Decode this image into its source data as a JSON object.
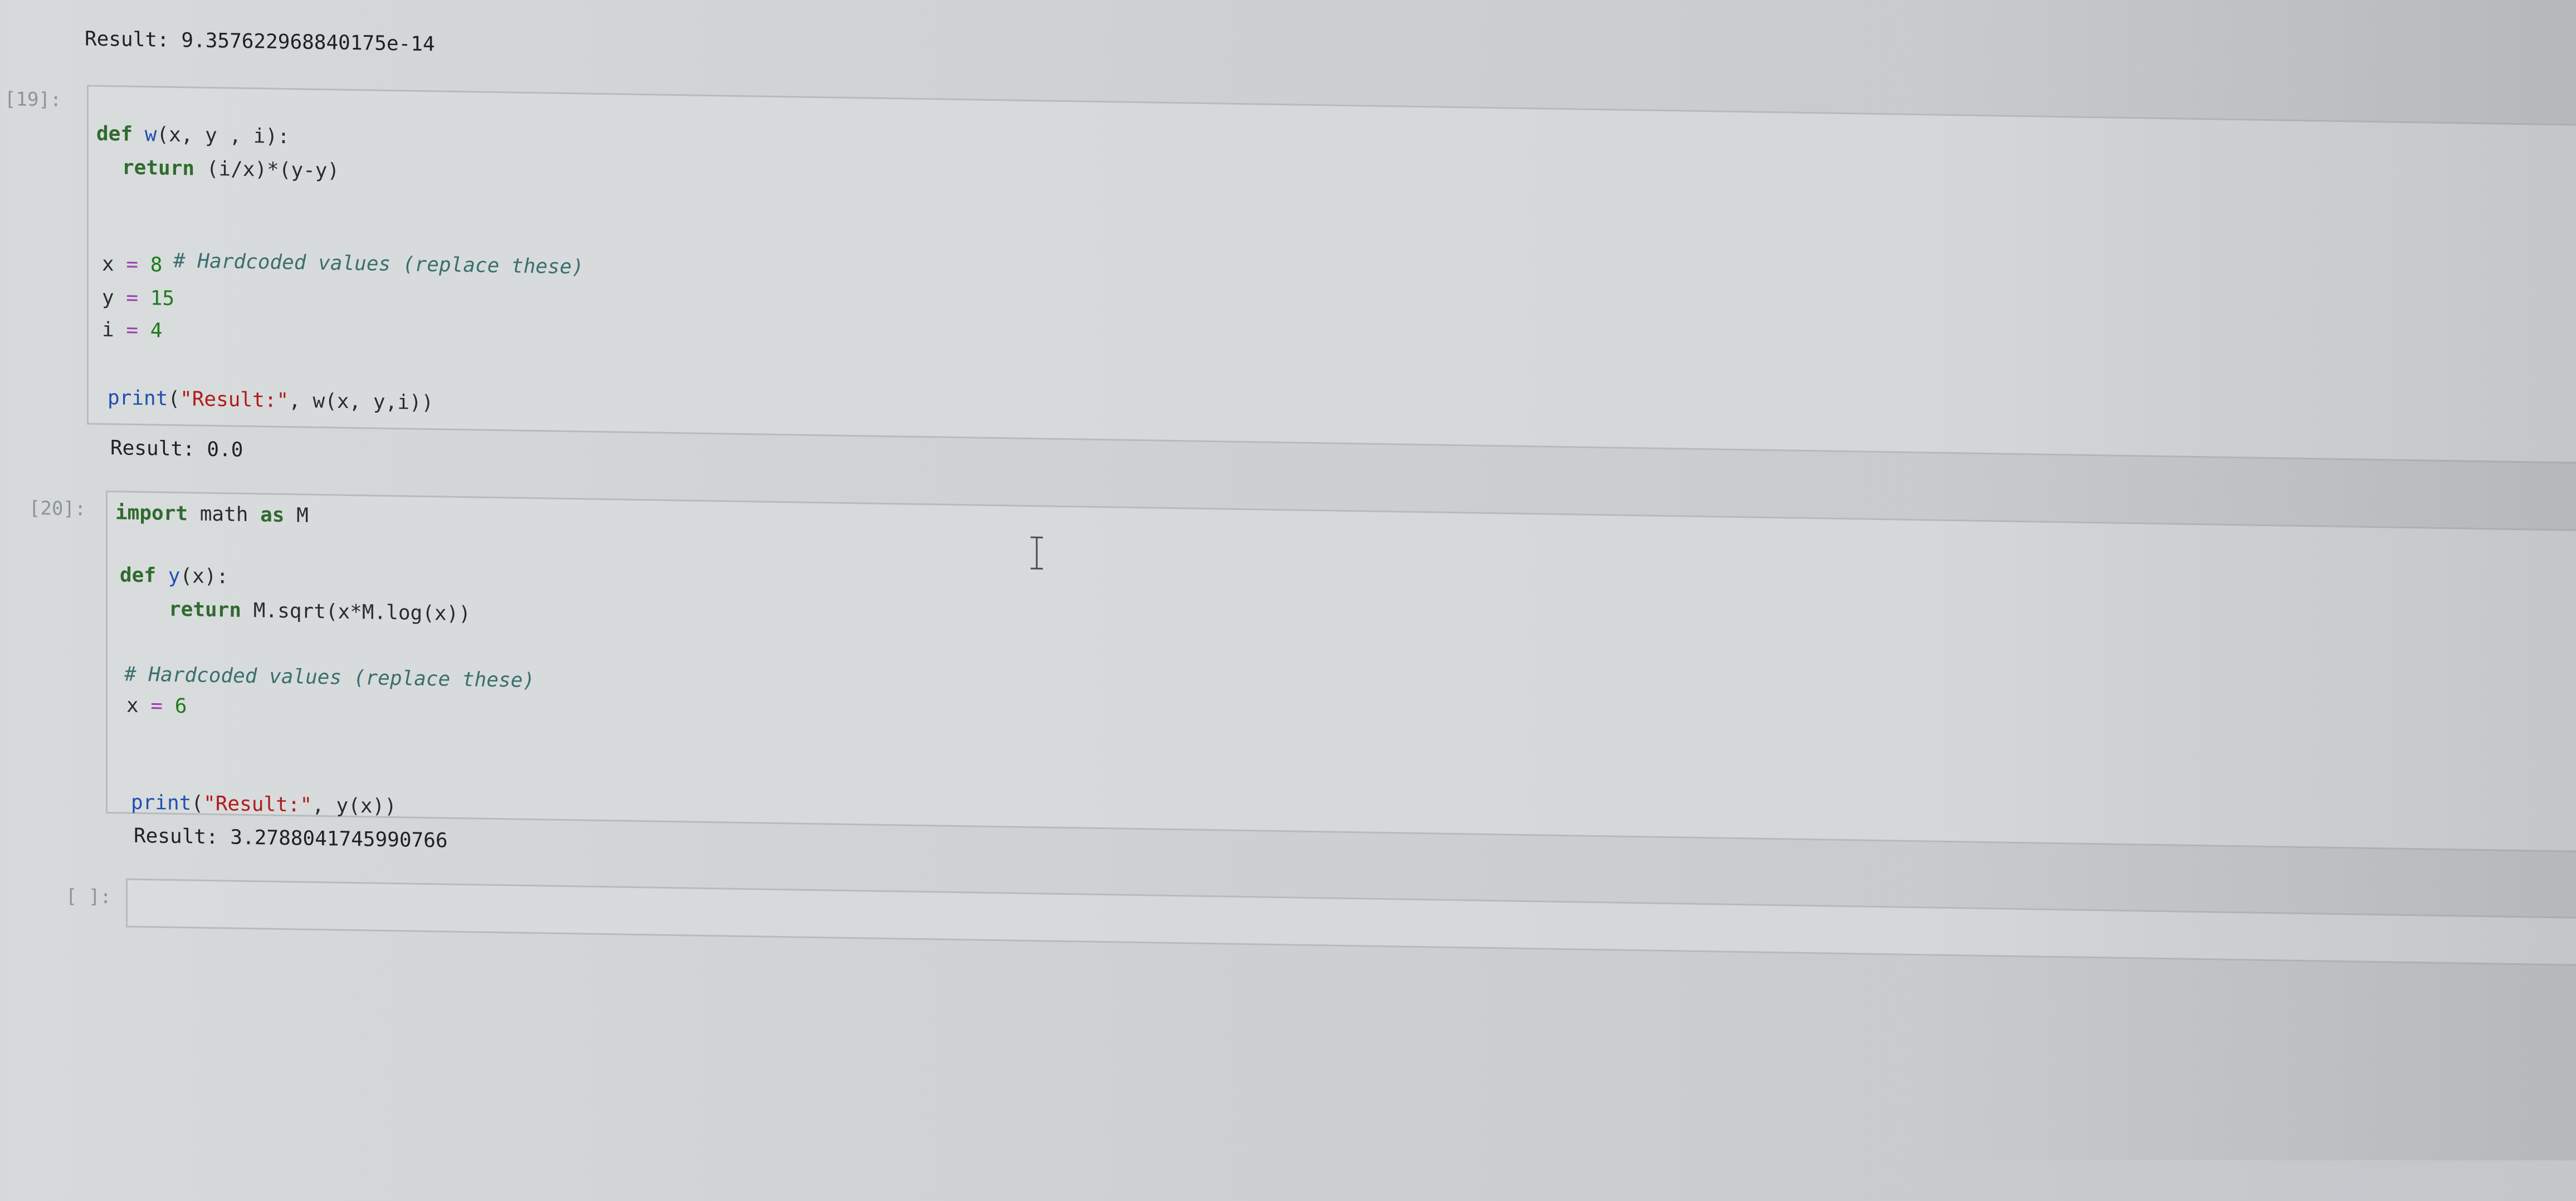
{
  "top_output": {
    "text": "Result: 9.357622968840175e-14"
  },
  "cells": [
    {
      "prompt": "[19]:",
      "code": [
        [
          "def w(x, y , i):"
        ],
        [
          "  return (i/x)*(y-y)"
        ],
        [
          ""
        ],
        [
          "# Hardcoded values (replace these)"
        ],
        [
          "x = 8"
        ],
        [
          "y = 15"
        ],
        [
          "i = 4"
        ],
        [
          ""
        ],
        [
          "print(\"Result:\", w(x, y,i))"
        ]
      ],
      "output": "Result: 0.0"
    },
    {
      "prompt": "[20]:",
      "code": [
        [
          "import math as M"
        ],
        [
          ""
        ],
        [
          "def y(x):"
        ],
        [
          "    return M.sqrt(x*M.log(x))"
        ],
        [
          ""
        ],
        [
          "# Hardcoded values (replace these)"
        ],
        [
          "x = 6"
        ],
        [
          ""
        ],
        [
          ""
        ],
        [
          "print(\"Result:\", y(x))"
        ]
      ],
      "output": "Result: 3.2788041745990766"
    },
    {
      "prompt": "[ ]:",
      "code": [],
      "output": ""
    }
  ],
  "icons": {
    "text_cursor": "text-cursor-icon"
  },
  "colors": {
    "keyword": "#2f6b2f",
    "function": "#1f4fb0",
    "string": "#b11a1a",
    "comment": "#3b6f6f",
    "number": "#1d7a1d"
  }
}
